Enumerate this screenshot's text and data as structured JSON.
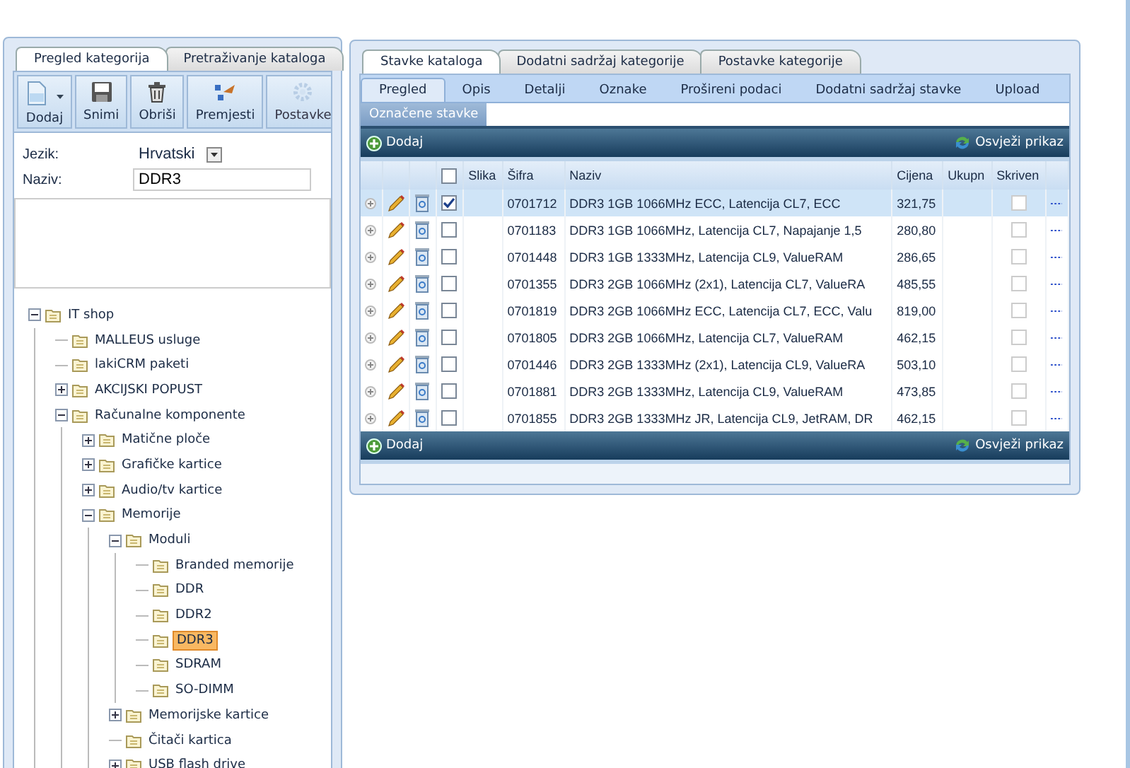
{
  "left_panel": {
    "tabs": [
      {
        "label": "Pregled kategorija",
        "selected": true
      },
      {
        "label": "Pretraživanje kataloga",
        "selected": false
      }
    ],
    "toolbar": [
      {
        "label": "Dodaj",
        "kind": "new",
        "dropdown": true,
        "disabled": false
      },
      {
        "label": "Snimi",
        "kind": "save",
        "dropdown": false,
        "disabled": false
      },
      {
        "label": "Obriši",
        "kind": "delete",
        "dropdown": false,
        "disabled": false
      },
      {
        "label": "Premjesti",
        "kind": "move",
        "dropdown": false,
        "disabled": false
      },
      {
        "label": "Postavke",
        "kind": "settings",
        "dropdown": false,
        "disabled": true
      }
    ],
    "fields": {
      "language_label": "Jezik:",
      "language_value": "Hrvatski",
      "name_label": "Naziv:",
      "name_value": "DDR3"
    },
    "tree": [
      {
        "label": "IT shop",
        "kind": "expanded",
        "selected": false,
        "children": [
          {
            "label": "MALLEUS usluge",
            "kind": "leaf",
            "selected": false
          },
          {
            "label": "lakiCRM paketi",
            "kind": "leaf",
            "selected": false
          },
          {
            "label": "AKCIJSKI POPUST",
            "kind": "collapsed",
            "selected": false
          },
          {
            "label": "Računalne komponente",
            "kind": "expanded",
            "selected": false,
            "children": [
              {
                "label": "Matične ploče",
                "kind": "collapsed",
                "selected": false
              },
              {
                "label": "Grafičke kartice",
                "kind": "collapsed",
                "selected": false
              },
              {
                "label": "Audio/tv kartice",
                "kind": "collapsed",
                "selected": false
              },
              {
                "label": "Memorije",
                "kind": "expanded",
                "selected": false,
                "children": [
                  {
                    "label": "Moduli",
                    "kind": "expanded",
                    "selected": false,
                    "children": [
                      {
                        "label": "Branded memorije",
                        "kind": "leaf",
                        "selected": false
                      },
                      {
                        "label": "DDR",
                        "kind": "leaf",
                        "selected": false
                      },
                      {
                        "label": "DDR2",
                        "kind": "leaf",
                        "selected": false
                      },
                      {
                        "label": "DDR3",
                        "kind": "leaf",
                        "selected": true
                      },
                      {
                        "label": "SDRAM",
                        "kind": "leaf",
                        "selected": false
                      },
                      {
                        "label": "SO-DIMM",
                        "kind": "leaf",
                        "selected": false
                      }
                    ]
                  },
                  {
                    "label": "Memorijske kartice",
                    "kind": "collapsed",
                    "selected": false
                  },
                  {
                    "label": "Čitači kartica",
                    "kind": "leaf",
                    "selected": false
                  },
                  {
                    "label": "USB flash drive",
                    "kind": "collapsed",
                    "selected": false
                  }
                ]
              }
            ]
          }
        ]
      }
    ]
  },
  "right_panel": {
    "tabs": [
      {
        "label": "Stavke kataloga",
        "selected": true
      },
      {
        "label": "Dodatni sadržaj kategorije",
        "selected": false
      },
      {
        "label": "Postavke kategorije",
        "selected": false
      }
    ],
    "sub_tabs": [
      {
        "label": "Pregled",
        "selected": true
      },
      {
        "label": "Opis",
        "selected": false
      },
      {
        "label": "Detalji",
        "selected": false
      },
      {
        "label": "Oznake",
        "selected": false
      },
      {
        "label": "Prošireni podaci",
        "selected": false
      },
      {
        "label": "Dodatni sadržaj stavke",
        "selected": false
      },
      {
        "label": "Upload",
        "selected": false
      }
    ],
    "third_tabs": [
      {
        "label": "Označene stavke",
        "selected": true
      }
    ],
    "grid": {
      "top_bar": {
        "add_label": "Dodaj",
        "refresh_label": "Osvježi prikaz"
      },
      "bottom_bar": {
        "add_label": "Dodaj",
        "refresh_label": "Osvježi prikaz"
      },
      "header_checked": false,
      "columns": [
        "Slika",
        "Šifra",
        "Naziv",
        "Cijena",
        "Ukupn",
        "Skriven"
      ],
      "rows": [
        {
          "code": "0701712",
          "name": "DDR3 1GB 1066MHz ECC, Latencija CL7, ECC",
          "price": "321,75",
          "checked": true,
          "hidden": false,
          "selected": true
        },
        {
          "code": "0701183",
          "name": "DDR3 1GB 1066MHz, Latencija CL7, Napajanje 1,5",
          "price": "280,80",
          "checked": false,
          "hidden": false,
          "selected": false
        },
        {
          "code": "0701448",
          "name": "DDR3 1GB 1333MHz, Latencija CL9, ValueRAM",
          "price": "286,65",
          "checked": false,
          "hidden": false,
          "selected": false
        },
        {
          "code": "0701355",
          "name": "DDR3 2GB 1066MHz (2x1), Latencija CL7, ValueRA",
          "price": "485,55",
          "checked": false,
          "hidden": false,
          "selected": false
        },
        {
          "code": "0701819",
          "name": "DDR3 2GB 1066MHz ECC, Latencija CL7, ECC, Valu",
          "price": "819,00",
          "checked": false,
          "hidden": false,
          "selected": false
        },
        {
          "code": "0701805",
          "name": "DDR3 2GB 1066MHz, Latencija CL7, ValueRAM",
          "price": "462,15",
          "checked": false,
          "hidden": false,
          "selected": false
        },
        {
          "code": "0701446",
          "name": "DDR3 2GB 1333MHz (2x1), Latencija CL9, ValueRA",
          "price": "503,10",
          "checked": false,
          "hidden": false,
          "selected": false
        },
        {
          "code": "0701881",
          "name": "DDR3 2GB 1333MHz, Latencija CL9, ValueRAM",
          "price": "473,85",
          "checked": false,
          "hidden": false,
          "selected": false
        },
        {
          "code": "0701855",
          "name": "DDR3 2GB 1333MHz JR, Latencija CL9, JetRAM, DR",
          "price": "462,15",
          "checked": false,
          "hidden": false,
          "selected": false
        }
      ]
    }
  }
}
